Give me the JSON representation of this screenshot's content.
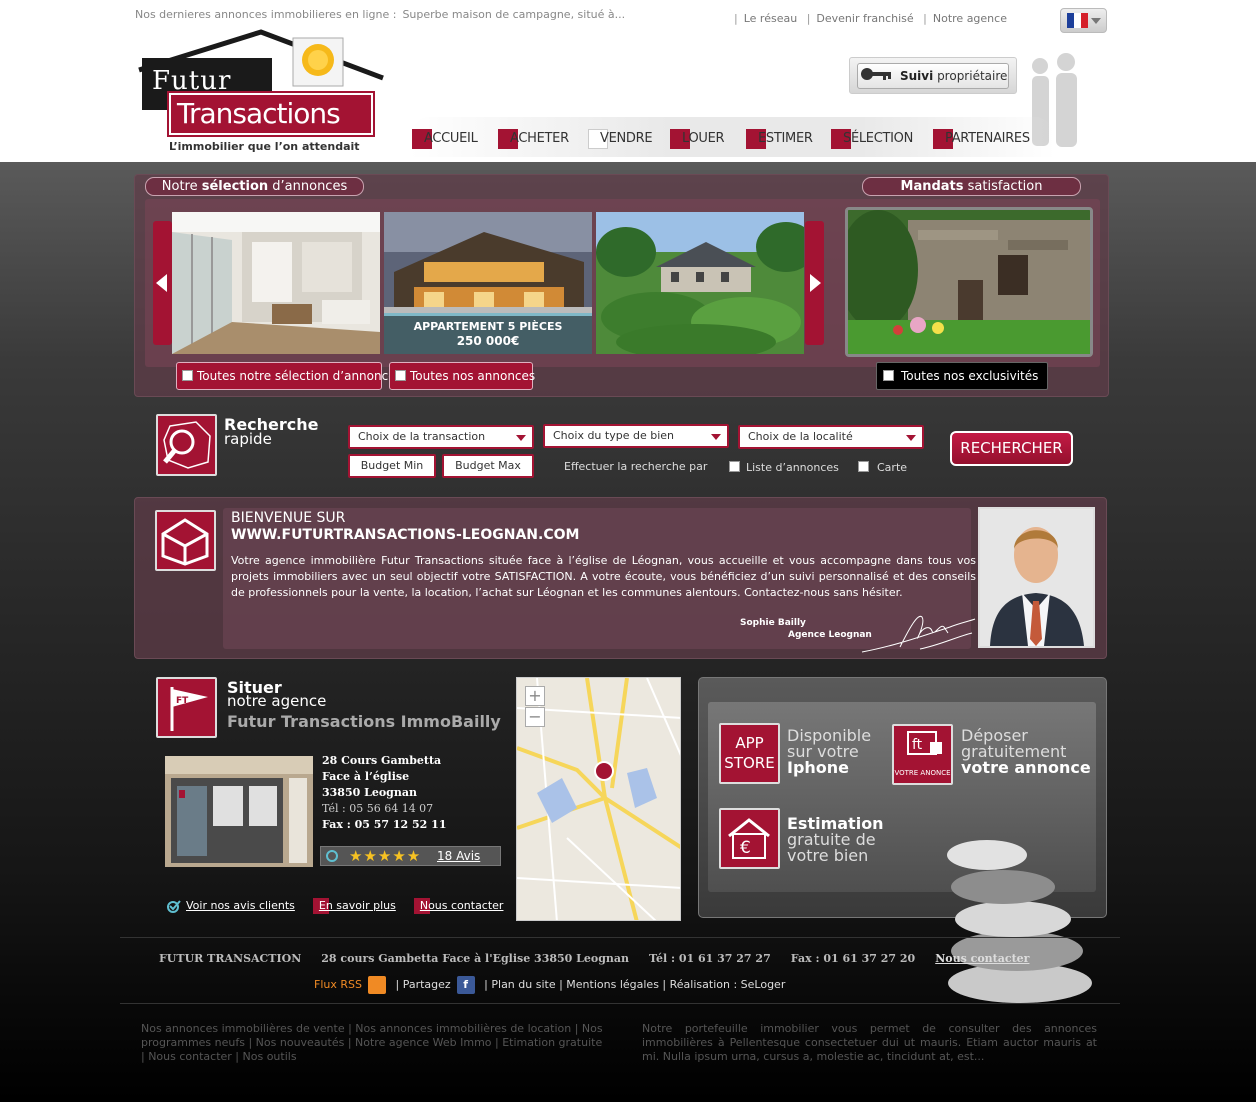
{
  "header": {
    "ticker_label": "Nos dernieres annonces immobilieres en ligne :",
    "ticker_item": "Superbe maison de campagne, situé à...",
    "top_links": [
      "Le réseau",
      "Devenir franchisé",
      "Notre agence"
    ],
    "logo": {
      "futur": "Futur",
      "transactions": "Transactions",
      "tagline": "L’immobilier que l’on attendait"
    },
    "suivi_bold": "Suivi",
    "suivi_rest": "propriétaire"
  },
  "nav": [
    "ACCUEIL",
    "ACHETER",
    "VENDRE",
    "LOUER",
    "ESTIMER",
    "SÉLECTION",
    "PARTENAIRES"
  ],
  "selection": {
    "title_pre": "Notre",
    "title_bold": "sélection",
    "title_post": "d’annonces",
    "mandats_bold": "Mandats",
    "mandats_rest": "satisfaction",
    "caption_title": "APPARTEMENT 5 PIÈCES",
    "caption_price": "250 000€",
    "btn_all_selection": "Toutes notre sélection d’annonce",
    "btn_all_annonces": "Toutes nos annonces",
    "btn_exclusivites": "Toutes nos exclusivités"
  },
  "search": {
    "title1": "Recherche",
    "title2": "rapide",
    "transaction": "Choix de la transaction",
    "type_bien": "Choix du type de bien",
    "localite": "Choix de la localité",
    "budget_min": "Budget Min",
    "budget_max": "Budget Max",
    "effectuer": "Effectuer la recherche par",
    "opt_liste": "Liste d’annonces",
    "opt_carte": "Carte",
    "button": "RECHERCHER"
  },
  "welcome": {
    "line1": "BIENVENUE SUR",
    "line2": "WWW.FUTURTRANSACTIONS-LEOGNAN.COM",
    "text": "Votre agence immobilière Futur Transactions située face à l’église de Léognan, vous accueille et vous accompagne dans tous vos projets immobiliers avec un seul objectif votre SATISFACTION. A votre écoute, vous bénéficiez d’un suivi personnalisé et des conseils de professionnels pour la vente, la location, l’achat sur Léognan et les communes alentours. Contactez-nous sans hésiter.",
    "sign_name": "Sophie Bailly",
    "sign_role": "Agence Leognan"
  },
  "agence": {
    "title1": "Situer",
    "title2": "notre agence",
    "title3": "Futur Transactions ImmoBailly",
    "addr1": "28 Cours Gambetta",
    "addr2": "Face à l’église",
    "addr3": "33850 Leognan",
    "tel": "Tél : 05 56 64 14 07",
    "fax": "Fax : 05 57 12 52 11",
    "stars": 5,
    "avis": "18 Avis",
    "link_avis": "Voir nos avis clients",
    "link_savoir": "En savoir plus",
    "link_contact": "Nous contacter"
  },
  "apps": {
    "app_store_1": "APP",
    "app_store_2": "STORE",
    "dispo_1": "Disponible",
    "dispo_2": "sur votre",
    "dispo_3": "Iphone",
    "ft_label": "VOTRE ANONCE",
    "deposer_1": "Déposer",
    "deposer_2": "gratuitement",
    "deposer_3": "votre annonce",
    "estim_1": "Estimation",
    "estim_2": "gratuite de",
    "estim_3": "votre bien"
  },
  "footer": {
    "company": "FUTUR TRANSACTION",
    "address": "28 cours Gambetta Face à l'Eglise 33850 Leognan",
    "tel": "Tél : 01 61 37 27 27",
    "fax": "Fax : 01 61 37 27 20",
    "contact": "Nous contacter",
    "rss": "Flux RSS",
    "partagez": "Partagez",
    "plan": "Plan du site",
    "mentions": "Mentions légales",
    "realisation": "Réalisation : SeLoger",
    "seo_links": "Nos annonces immobilières de vente | Nos annonces immobilières de location | Nos programmes neufs | Nos nouveautés | Notre agence Web Immo | Etimation gratuite | Nous contacter | Nos outils",
    "seo_text": "Notre portefeuille immobilier vous permet de consulter des annonces immobilières à Pellentesque consectetuer dui ut mauris. Etiam auctor mauris at mi. Nulla ipsum urna, cursus a, molestie ac, tincidunt at, est..."
  },
  "colors": {
    "brand": "#a31333",
    "dark": "#1a1a1a"
  }
}
